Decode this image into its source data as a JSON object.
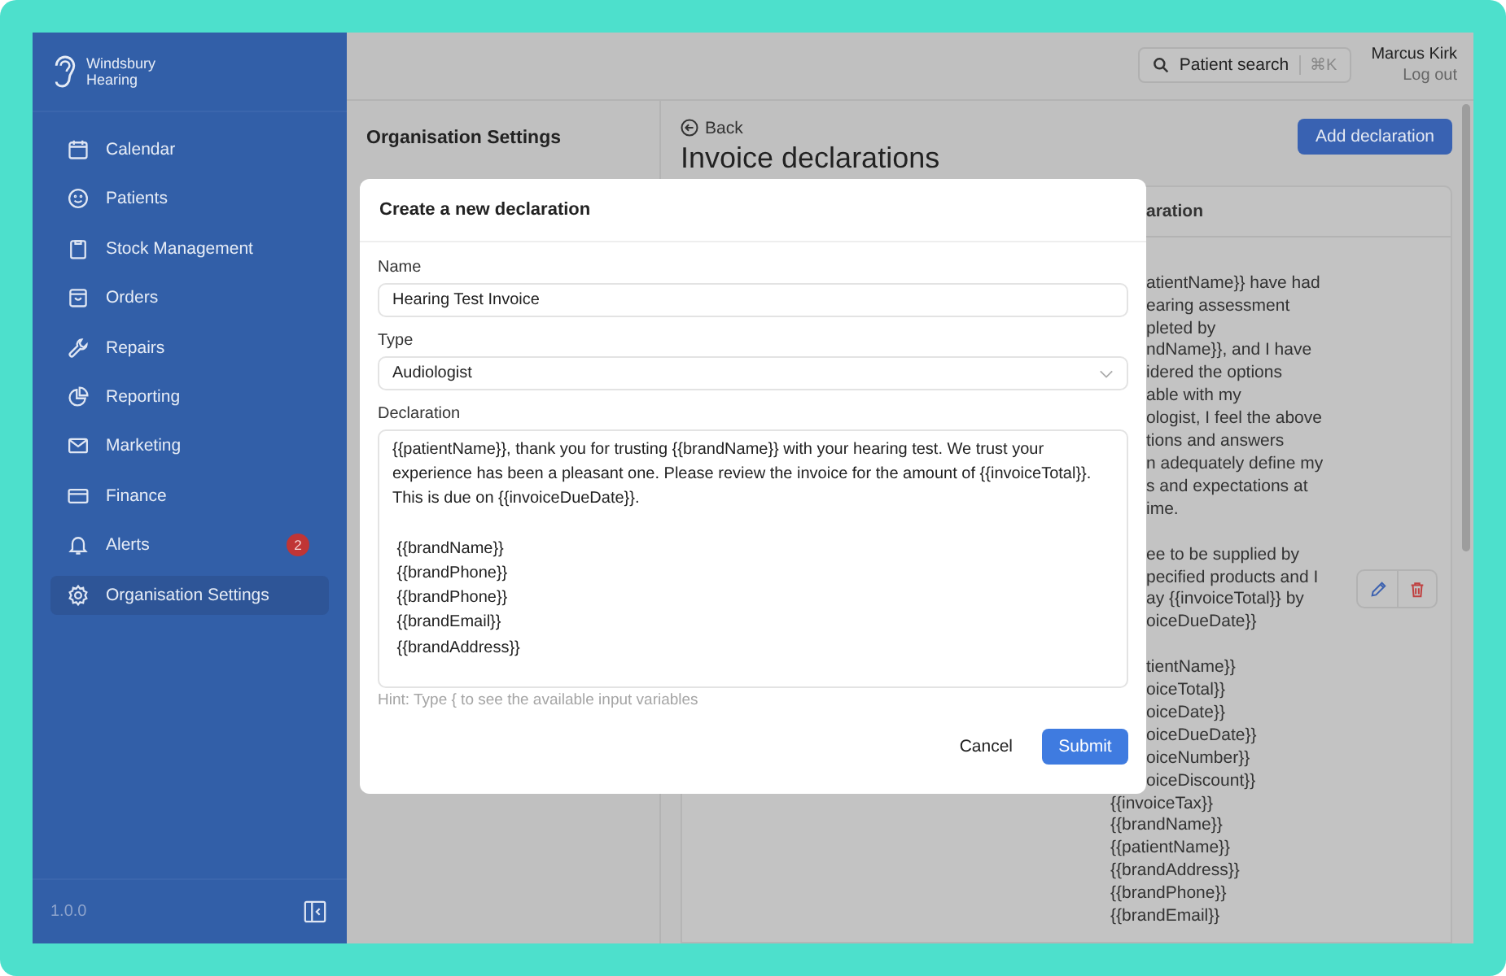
{
  "sidebar": {
    "logo": [
      "Windsbury",
      "Hearing"
    ],
    "items": [
      {
        "label": "Calendar",
        "selected": false
      },
      {
        "label": "Patients",
        "selected": false
      },
      {
        "label": "Stock Management",
        "selected": false
      },
      {
        "label": "Orders",
        "selected": false
      },
      {
        "label": "Repairs",
        "selected": false
      },
      {
        "label": "Reporting",
        "selected": false
      },
      {
        "label": "Marketing",
        "selected": false
      },
      {
        "label": "Finance",
        "selected": false
      },
      {
        "label": "Alerts",
        "selected": false,
        "badge": "2"
      },
      {
        "label": "Organisation Settings",
        "selected": true
      }
    ],
    "version": "1.0.0"
  },
  "header": {
    "search": {
      "label": "Patient search",
      "shortcut": "⌘K"
    },
    "user": "Marcus Kirk",
    "logout": "Log out"
  },
  "settings_nav": {
    "title": "Organisation Settings"
  },
  "content": {
    "back": "Back",
    "title": "Invoice declarations",
    "add_button": "Add declaration",
    "table": {
      "column_visible_part": "aration",
      "row": {
        "visible_paragraphs": [
          [
            "atientName}} have had",
            "earing assessment",
            "pleted by",
            "ndName}}, and I have",
            "idered the options",
            "able with my",
            "ologist, I feel the above",
            "tions and answers",
            "n adequately define my",
            "s and expectations at",
            "ime."
          ],
          [
            "ee to be supplied by",
            "pecified products and I",
            "ay {{invoiceTotal}} by",
            "oiceDueDate}}"
          ],
          [
            "tientName}}",
            "oiceTotal}}",
            "oiceDate}}",
            "oiceDueDate}}",
            "oiceNumber}}",
            "oiceDiscount}}"
          ]
        ],
        "tail_lines": [
          "{{invoiceTax}}",
          "{{brandName}}",
          "{{patientName}}",
          "{{brandAddress}}",
          "{{brandPhone}}",
          "{{brandEmail}}"
        ]
      }
    }
  },
  "modal": {
    "title": "Create a new declaration",
    "name": {
      "label": "Name",
      "value": "Hearing Test Invoice"
    },
    "type": {
      "label": "Type",
      "value": "Audiologist"
    },
    "declaration": {
      "label": "Declaration",
      "value": "{{patientName}}, thank you for trusting {{brandName}} with your hearing test. We trust your experience has been a pleasant one. Please review the invoice for the amount of {{invoiceTotal}}. This is due on {{invoiceDueDate}}.\n\n {{brandName}}\n {{brandPhone}}\n {{brandPhone}}\n {{brandEmail}}\n {{brandAddress}}"
    },
    "hint": "Hint: Type { to see the available input variables",
    "cancel": "Cancel",
    "submit": "Submit"
  }
}
